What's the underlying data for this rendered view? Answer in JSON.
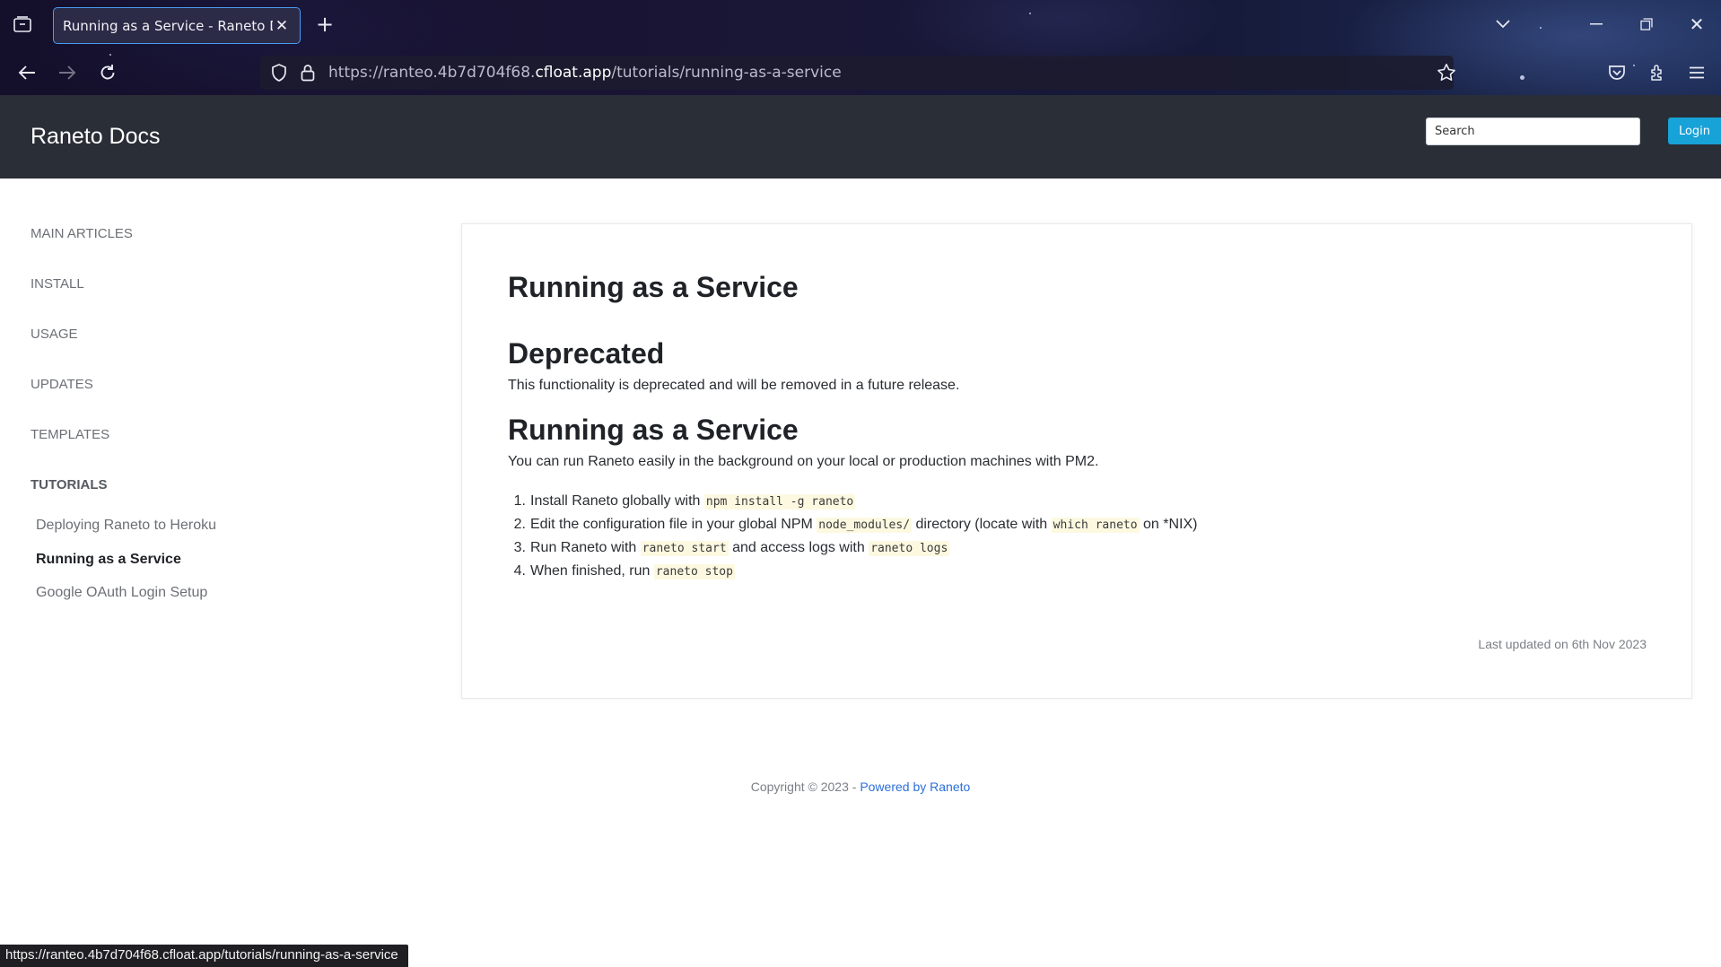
{
  "browser": {
    "tab_title": "Running as a Service - Raneto Docs",
    "url_prefix": "https://ranteo.4b7d704f68.",
    "url_host": "cfloat.app",
    "url_path": "/tutorials/running-as-a-service",
    "status_url": "https://ranteo.4b7d704f68.cfloat.app/tutorials/running-as-a-service"
  },
  "header": {
    "site_title": "Raneto Docs",
    "search_placeholder": "Search",
    "login_label": "Login"
  },
  "sidebar": {
    "categories": [
      {
        "label": "MAIN ARTICLES"
      },
      {
        "label": "INSTALL"
      },
      {
        "label": "USAGE"
      },
      {
        "label": "UPDATES"
      },
      {
        "label": "TEMPLATES"
      },
      {
        "label": "TUTORIALS",
        "active": true
      }
    ],
    "tutorials": [
      {
        "label": "Deploying Raneto to Heroku"
      },
      {
        "label": "Running as a Service",
        "current": true
      },
      {
        "label": "Google OAuth Login Setup"
      }
    ]
  },
  "article": {
    "title": "Running as a Service",
    "deprecated_heading": "Deprecated",
    "deprecated_text": "This functionality is deprecated and will be removed in a future release.",
    "running_heading": "Running as a Service",
    "running_text": "You can run Raneto easily in the background on your local or production machines with PM2.",
    "steps": [
      {
        "num": "1.",
        "a": "Install Raneto globally with ",
        "code1": "npm install -g raneto"
      },
      {
        "num": "2.",
        "a": "Edit the configuration file in your global NPM ",
        "code1": "node_modules/",
        "b": " directory (locate with ",
        "code2": "which raneto",
        "c": " on *NIX)"
      },
      {
        "num": "3.",
        "a": "Run Raneto with ",
        "code1": "raneto start",
        "b": " and access logs with ",
        "code2": "raneto logs"
      },
      {
        "num": "4.",
        "a": "When finished, run ",
        "code1": "raneto stop"
      }
    ],
    "last_updated": "Last updated on 6th Nov 2023"
  },
  "footer": {
    "copyright": "Copyright © 2023 - ",
    "powered_by": "Powered by Raneto"
  },
  "colors": {
    "header_bg": "#2a2e37",
    "login_button": "#17a2d8",
    "link": "#2d6fd8",
    "code_bg": "#fdf9e1"
  }
}
